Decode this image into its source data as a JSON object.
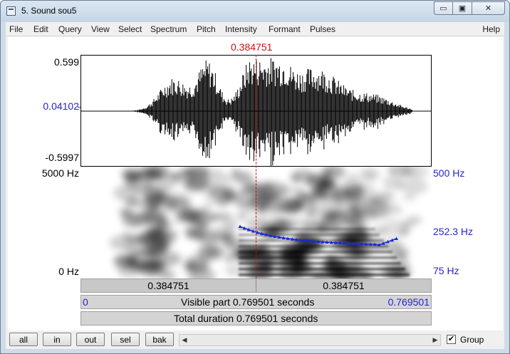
{
  "window": {
    "title": "5. Sound sou5",
    "minimize_glyph": "▭",
    "maximize_glyph": "▣",
    "close_glyph": "✕"
  },
  "menu": {
    "items": [
      "File",
      "Edit",
      "Query",
      "View",
      "Select",
      "Spectrum",
      "Pitch",
      "Intensity",
      "Formant",
      "Pulses"
    ],
    "help": "Help"
  },
  "cursor": {
    "time_label": "0.384751",
    "color": "#d01010"
  },
  "waveform": {
    "max_label": "0.599",
    "cursor_value_label": "0.04102",
    "min_label": "-0.5997"
  },
  "spectrogram": {
    "top_freq_label": "5000 Hz",
    "bottom_freq_label": "0 Hz"
  },
  "pitch": {
    "top_label": "500 Hz",
    "cursor_label": "252.3 Hz",
    "bottom_label": "75 Hz",
    "color": "#1a2ad8"
  },
  "bars": {
    "left_time": "0.384751",
    "right_time": "0.384751",
    "visible_start": "0",
    "visible_text": "Visible part 0.769501 seconds",
    "visible_end": "0.769501",
    "total_text": "Total duration 0.769501 seconds"
  },
  "buttons": {
    "all": "all",
    "in": "in",
    "out": "out",
    "sel": "sel",
    "bak": "bak"
  },
  "group": {
    "label": "Group",
    "checked": true,
    "check_glyph": "✔"
  },
  "scrollbar": {
    "left_glyph": "◀",
    "right_glyph": "▶"
  }
}
